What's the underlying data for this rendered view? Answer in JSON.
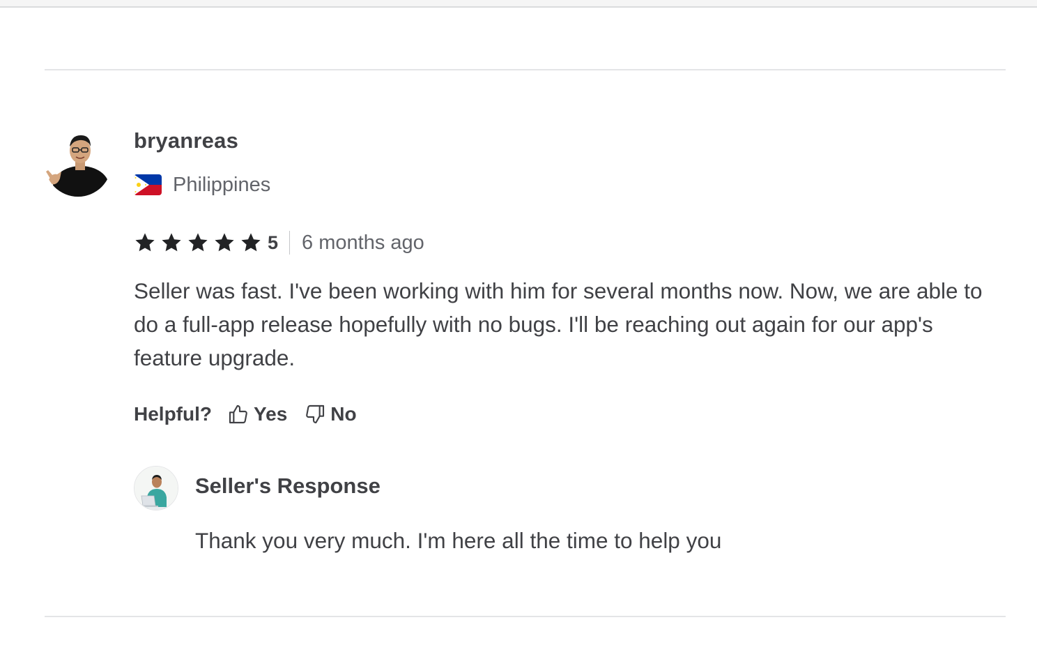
{
  "review": {
    "username": "bryanreas",
    "country": "Philippines",
    "flag_icon": "philippines-flag-icon",
    "rating": "5",
    "star_icon": "star-icon",
    "time_ago": "6 months ago",
    "text": "Seller was fast. I've been working with him for several months now. Now, we are able to do a full-app release hopefully with no bugs. I'll be reaching out again for our app's feature upgrade.",
    "helpful_label": "Helpful?",
    "yes_label": "Yes",
    "no_label": "No"
  },
  "seller_response": {
    "title": "Seller's Response",
    "text": "Thank you very much. I'm here all the time to help you"
  },
  "colors": {
    "text_primary": "#404145",
    "text_secondary": "#62646a",
    "divider": "#e4e5e7",
    "star": "#222325"
  }
}
